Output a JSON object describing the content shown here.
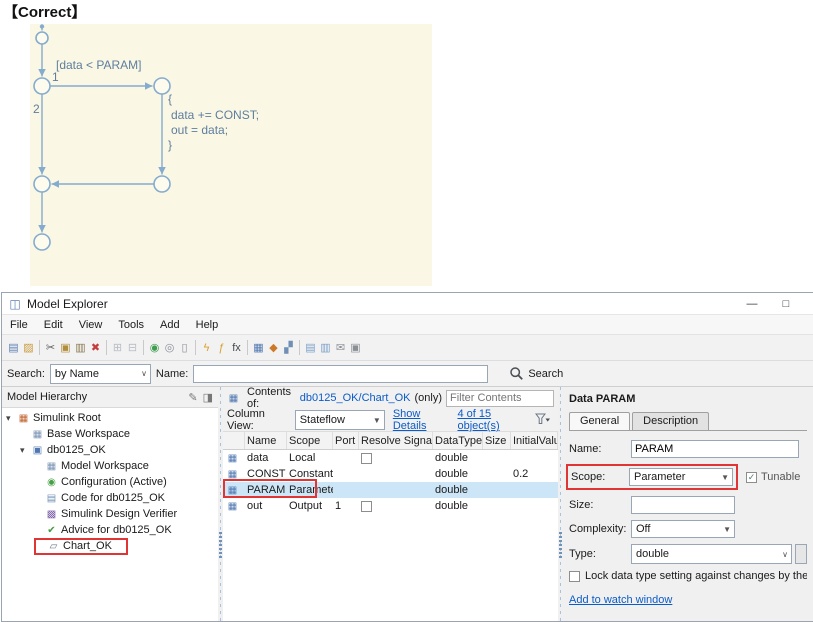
{
  "page": {
    "correct_label": "【Correct】"
  },
  "colors": {
    "red_highlight": "#e03535",
    "selected_row": "#cde6f7",
    "link_blue": "#0b5cc8",
    "table_icon": "#4f77b0",
    "canvas_bg": "#faf8e4",
    "diagram_stroke": "#85abce",
    "diagram_text": "#5e7d9f"
  },
  "icons": {
    "app": "◫",
    "minimize": "—",
    "maximize": "□",
    "chevron_expanded": "▾",
    "dropdown_arrow": "▼",
    "combo_arrow": "∨",
    "check": "✓",
    "grid": "▦",
    "pencil": "✎",
    "camera": "◨"
  },
  "diagram": {
    "transition_label": "[data < PARAM]",
    "branch_1": "1",
    "branch_2": "2",
    "action_open": "{",
    "action_line1": "data += CONST;",
    "action_line2": "out = data;",
    "action_close": "}"
  },
  "window": {
    "title": "Model Explorer"
  },
  "menu": {
    "items": [
      "File",
      "Edit",
      "View",
      "Tools",
      "Add",
      "Help"
    ]
  },
  "toolbar": {
    "icons": [
      {
        "name": "new-model-icon",
        "glyph": "▤",
        "color": "#5b7fb4"
      },
      {
        "name": "open-folder-icon",
        "glyph": "▨",
        "color": "#c99a3a"
      },
      {
        "name": "cut-icon",
        "glyph": "✂",
        "color": "#5a5a5a"
      },
      {
        "name": "copy-icon",
        "glyph": "▣",
        "color": "#b28d3c"
      },
      {
        "name": "paste-icon",
        "glyph": "▥",
        "color": "#8a774f"
      },
      {
        "name": "delete-icon",
        "glyph": "✖",
        "color": "#c43c3c"
      },
      {
        "name": "tile-layout-icon",
        "glyph": "⊞",
        "color": "#b8bec6"
      },
      {
        "name": "single-layout-icon",
        "glyph": "⊟",
        "color": "#b8bec6"
      },
      {
        "name": "record-icon",
        "glyph": "◉",
        "color": "#3f9d4f"
      },
      {
        "name": "snapshot-icon",
        "glyph": "◎",
        "color": "#8a8f96"
      },
      {
        "name": "page-icon",
        "glyph": "▯",
        "color": "#8a8f96"
      },
      {
        "name": "parse-icon",
        "glyph": "ϟ",
        "color": "#d9a22e"
      },
      {
        "name": "run-function-icon",
        "glyph": "ƒ",
        "color": "#d9a22e"
      },
      {
        "name": "fx-icon",
        "glyph": "fx",
        "color": "#44484e"
      },
      {
        "name": "table-view-icon",
        "glyph": "▦",
        "color": "#4f77b0"
      },
      {
        "name": "compare-icon",
        "glyph": "◆",
        "color": "#cc7a29"
      },
      {
        "name": "grid-pair-icon",
        "glyph": "▞",
        "color": "#6f8fb5"
      },
      {
        "name": "report-icon",
        "glyph": "▤",
        "color": "#7aa0c8"
      },
      {
        "name": "export-icon",
        "glyph": "▥",
        "color": "#7aa0c8"
      },
      {
        "name": "mail-icon",
        "glyph": "✉",
        "color": "#8a8f96"
      },
      {
        "name": "print-icon",
        "glyph": "▣",
        "color": "#8a8f96"
      }
    ]
  },
  "search": {
    "label": "Search:",
    "mode_value": "by Name",
    "name_label": "Name:",
    "name_value": "",
    "button_label": "Search"
  },
  "hierarchy": {
    "title": "Model Hierarchy",
    "items": [
      {
        "label": "Simulink Root",
        "glyph": "▦",
        "color": "#c0622b",
        "level": 0,
        "expanded": true
      },
      {
        "label": "Base Workspace",
        "glyph": "▦",
        "color": "#7a93b5",
        "level": 1,
        "expanded": false
      },
      {
        "label": "db0125_OK",
        "glyph": "▣",
        "color": "#4f77b0",
        "level": 1,
        "expanded": true
      },
      {
        "label": "Model Workspace",
        "glyph": "▦",
        "color": "#7a93b5",
        "level": 2,
        "expanded": false
      },
      {
        "label": "Configuration (Active)",
        "glyph": "◉",
        "color": "#46a046",
        "level": 2,
        "expanded": false
      },
      {
        "label": "Code for db0125_OK",
        "glyph": "▤",
        "color": "#6f8fb5",
        "level": 2,
        "expanded": false
      },
      {
        "label": "Simulink Design Verifier",
        "glyph": "▩",
        "color": "#7f62a8",
        "level": 2,
        "expanded": false
      },
      {
        "label": "Advice for db0125_OK",
        "glyph": "✔",
        "color": "#3f9d3f",
        "level": 2,
        "expanded": false
      },
      {
        "label": "Chart_OK",
        "glyph": "▱",
        "color": "#6b7480",
        "level": 2,
        "expanded": false
      }
    ]
  },
  "contents": {
    "prefix": "Contents of:",
    "path_link": "db0125_OK/Chart_OK",
    "suffix": "(only)",
    "filter_placeholder": "Filter Contents",
    "column_view_label": "Column View:",
    "column_view_value": "Stateflow",
    "show_details_link": "Show Details",
    "count_link": "4 of 15 object(s)",
    "columns": {
      "name": "Name",
      "scope": "Scope",
      "port": "Port",
      "resolve": "Resolve Signal",
      "datatype": "DataType",
      "size": "Size",
      "initial": "InitialValu"
    },
    "rows": [
      {
        "name": "data",
        "scope": "Local",
        "port": "",
        "datatype": "double",
        "size": "",
        "initial": ""
      },
      {
        "name": "CONST",
        "scope": "Constant",
        "port": "",
        "datatype": "double",
        "size": "",
        "initial": "0.2"
      },
      {
        "name": "PARAM",
        "scope": "Parameter",
        "port": "",
        "datatype": "double",
        "size": "",
        "initial": ""
      },
      {
        "name": "out",
        "scope": "Output",
        "port": "1",
        "datatype": "double",
        "size": "",
        "initial": ""
      }
    ]
  },
  "inspector": {
    "title": "Data PARAM",
    "tab_general": "General",
    "tab_description": "Description",
    "name_label": "Name:",
    "name_value": "PARAM",
    "scope_label": "Scope:",
    "scope_value": "Parameter",
    "tunable_label": "Tunable",
    "size_label": "Size:",
    "size_value": "",
    "complexity_label": "Complexity:",
    "complexity_value": "Off",
    "type_label": "Type:",
    "type_value": "double",
    "lock_label": "Lock data type setting against changes by the fixe",
    "watch_link": "Add to watch window"
  }
}
